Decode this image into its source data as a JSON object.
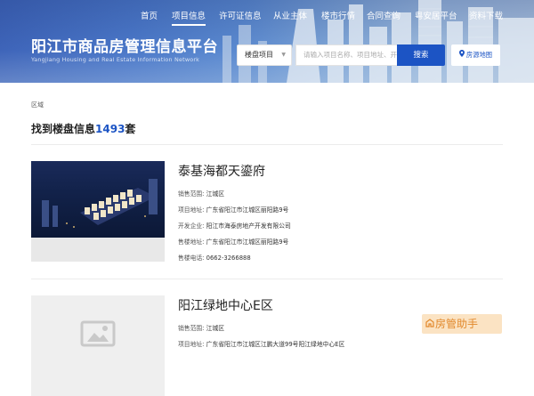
{
  "nav": {
    "items": [
      {
        "label": "首页"
      },
      {
        "label": "项目信息",
        "active": true
      },
      {
        "label": "许可证信息"
      },
      {
        "label": "从业主体"
      },
      {
        "label": "楼市行情"
      },
      {
        "label": "合同查询"
      },
      {
        "label": "粤安居平台"
      },
      {
        "label": "资料下载"
      }
    ]
  },
  "header": {
    "title": "阳江市商品房管理信息平台",
    "subtitle": "Yangjiang Housing and Real Estate Information Network"
  },
  "search": {
    "category": "楼盘项目",
    "placeholder": "请输入项目名称、项目地址、开",
    "button_label": "搜索",
    "map_button_label": "房源地图"
  },
  "filter": {
    "label": "区域"
  },
  "result": {
    "prefix": "找到楼盘信息",
    "count": "1493",
    "suffix": "套"
  },
  "listings": [
    {
      "name": "泰基海都天鎏府",
      "has_photo": true,
      "fields": [
        {
          "key": "销售范围:",
          "value": "江城区"
        },
        {
          "key": "项目地址:",
          "value": "广东省阳江市江城区丽阳路9号"
        },
        {
          "key": "开发企业:",
          "value": "阳江市海泰房地产开发有限公司"
        },
        {
          "key": "售楼地址:",
          "value": "广东省阳江市江城区丽阳路9号"
        },
        {
          "key": "售楼电话:",
          "value": "0662-3266888"
        }
      ]
    },
    {
      "name": "阳江绿地中心E区",
      "has_photo": false,
      "fields": [
        {
          "key": "销售范围:",
          "value": "江城区"
        },
        {
          "key": "项目地址:",
          "value": "广东省阳江市江城区江鹏大道99号阳江绿地中心E区"
        }
      ]
    }
  ],
  "watermark": {
    "text": "房管助手"
  },
  "colors": {
    "brand_blue": "#1c54c4",
    "banner_blue": "#4a77c8",
    "watermark_bg": "#fbe3c3",
    "watermark_text": "#e2892c"
  },
  "icons": {
    "select_arrow": "chevron-down-icon",
    "map": "map-pin-icon",
    "placeholder": "image-placeholder-icon",
    "watermark": "house-icon"
  }
}
